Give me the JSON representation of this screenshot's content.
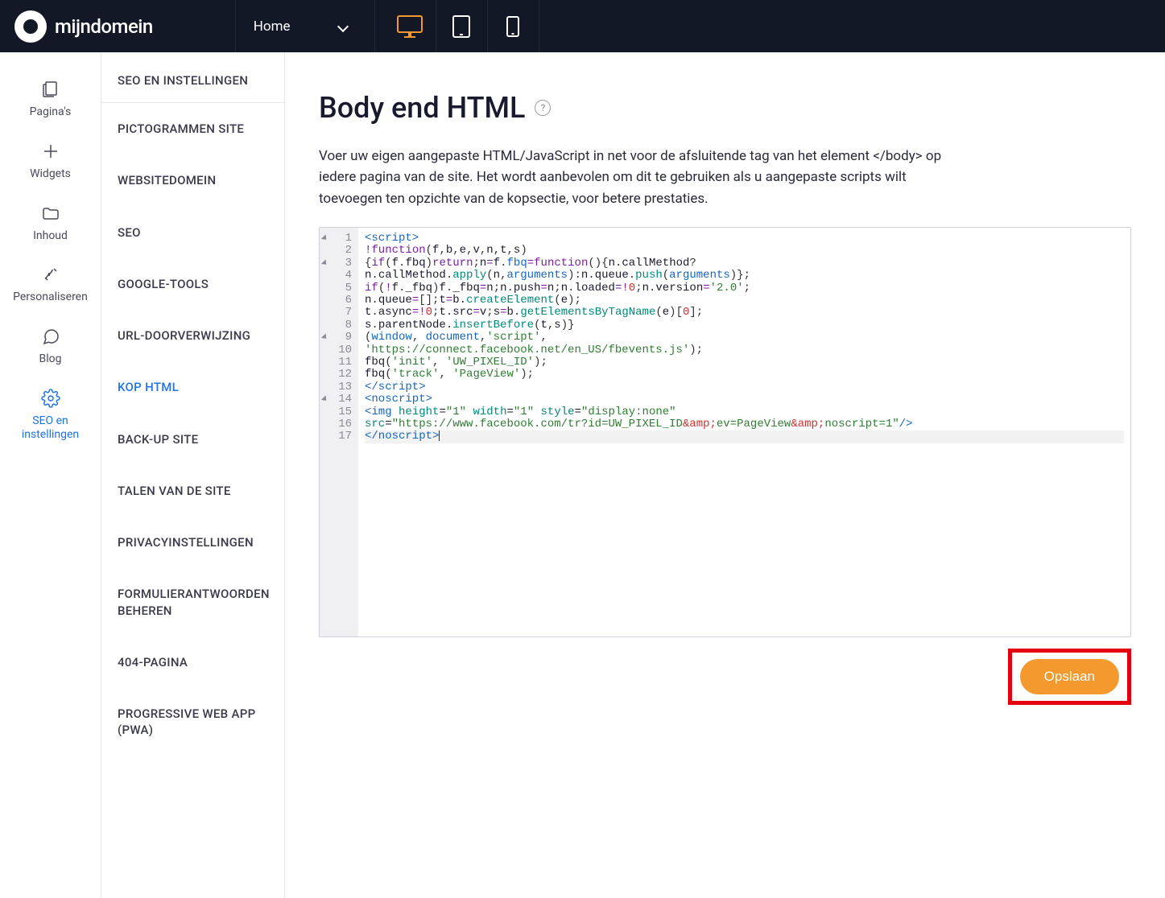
{
  "brand": "mijndomein",
  "topbar": {
    "page_selector": "Home"
  },
  "sidebar": {
    "items": [
      {
        "label": "Pagina's"
      },
      {
        "label": "Widgets"
      },
      {
        "label": "Inhoud"
      },
      {
        "label": "Personaliseren"
      },
      {
        "label": "Blog"
      },
      {
        "label": "SEO en instellingen"
      }
    ]
  },
  "subnav": {
    "header": "SEO EN INSTELLINGEN",
    "items": [
      "PICTOGRAMMEN SITE",
      "WEBSITEDOMEIN",
      "SEO",
      "GOOGLE-TOOLS",
      "URL-DOORVERWIJZING",
      "KOP HTML",
      "BACK-UP SITE",
      "TALEN VAN DE SITE",
      "PRIVACYINSTELLINGEN",
      "FORMULIERANTWOORDEN BEHEREN",
      "404-PAGINA",
      "PROGRESSIVE WEB APP (PWA)"
    ],
    "active_index": 5
  },
  "main": {
    "title": "Body end HTML",
    "description": "Voer uw eigen aangepaste HTML/JavaScript in net voor de afsluitende tag van het element </body> op iedere pagina van de site. Het wordt aanbevolen om dit te gebruiken als u aangepaste scripts wilt toevoegen ten opzichte van de kopsectie, voor betere prestaties.",
    "save_label": "Opslaan"
  },
  "code": {
    "line_count": 17,
    "raw": "<script>\n!function(f,b,e,v,n,t,s)\n{if(f.fbq)return;n=f.fbq=function(){n.callMethod?\nn.callMethod.apply(n,arguments):n.queue.push(arguments)};\nif(!f._fbq)f._fbq=n;n.push=n;n.loaded=!0;n.version='2.0';\nn.queue=[];t=b.createElement(e);\nt.async=!0;t.src=v;s=b.getElementsByTagName(e)[0];\ns.parentNode.insertBefore(t,s)}\n(window, document,'script',\n'https://connect.facebook.net/en_US/fbevents.js');\nfbq('init', 'UW_PIXEL_ID');\nfbq('track', 'PageView');\n</script>\n<noscript>\n<img height=\"1\" width=\"1\" style=\"display:none\"\nsrc=\"https://www.facebook.com/tr?id=UW_PIXEL_ID&amp;ev=PageView&amp;noscript=1\"/>\n</noscript>"
  }
}
